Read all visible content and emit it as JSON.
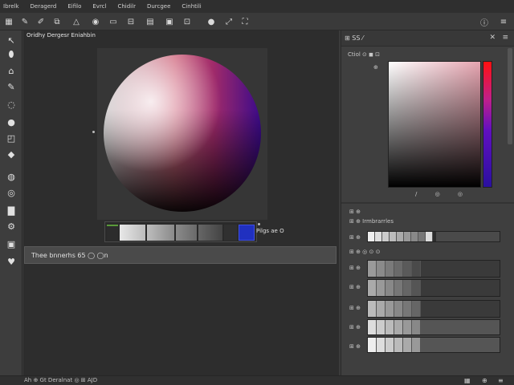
{
  "menu": [
    "Ibrelk",
    "Deragerd",
    "Eifilo",
    "Evrcl",
    "Chidilr",
    "Durcgee",
    "Cinhtili"
  ],
  "toolbar_icons": [
    "grid-icon",
    "brush-icon",
    "pen-icon",
    "triangle-icon",
    "eye-icon",
    "image-icon",
    "layers-icon",
    "folder-icon",
    "crop-icon",
    "circle-icon",
    "expand-icon",
    "export-icon",
    "info-icon",
    "menu-icon"
  ],
  "rail_icons": [
    "arrow-icon",
    "drop-icon",
    "arrow-up-icon",
    "brush-tool-icon",
    "lasso-icon",
    "dot-icon",
    "select-icon",
    "bucket-icon",
    "dial-icon",
    "swirl-icon",
    "stamp-icon",
    "gear-tool-icon",
    "crop-tool-icon",
    "heart-icon"
  ],
  "document": {
    "title": "Oridhy Dergesr Eniahbin",
    "strip_label": "Pilgs ae O",
    "info_text": "Thee bnnerhs 65 ◯ ◯n"
  },
  "panel": {
    "title": "⊞ SS ⁄",
    "subtitle": "Ctiol ⊙ ◼ ⊡",
    "picker_label": "⊕",
    "hue_marks": "/ ◎ ◎",
    "section_title": "⊞ ⊕ Irmbrarrles",
    "rows": [
      {
        "label": "⊞ ⊕",
        "fill": 0.52
      },
      {
        "label": "⊞ ⊕",
        "fill": 0.0
      },
      {
        "label": "⊞ ⊕",
        "fill": 0.0
      },
      {
        "label": "⊞ ⊕",
        "fill": 0.0
      },
      {
        "label": "⊞ ⊕",
        "fill": 0.0
      },
      {
        "label": "⊞ ⊕",
        "fill": 0.0
      }
    ],
    "row_section_b": "⊞ ⊕ ◎ ⊙ ⊙"
  },
  "status": {
    "text": "Ah ⊕ Gt Deralnat ◎ ⊞ AJD"
  },
  "colors": {
    "accent_blue": "#2030c0",
    "hue_top": "#ff1010"
  }
}
